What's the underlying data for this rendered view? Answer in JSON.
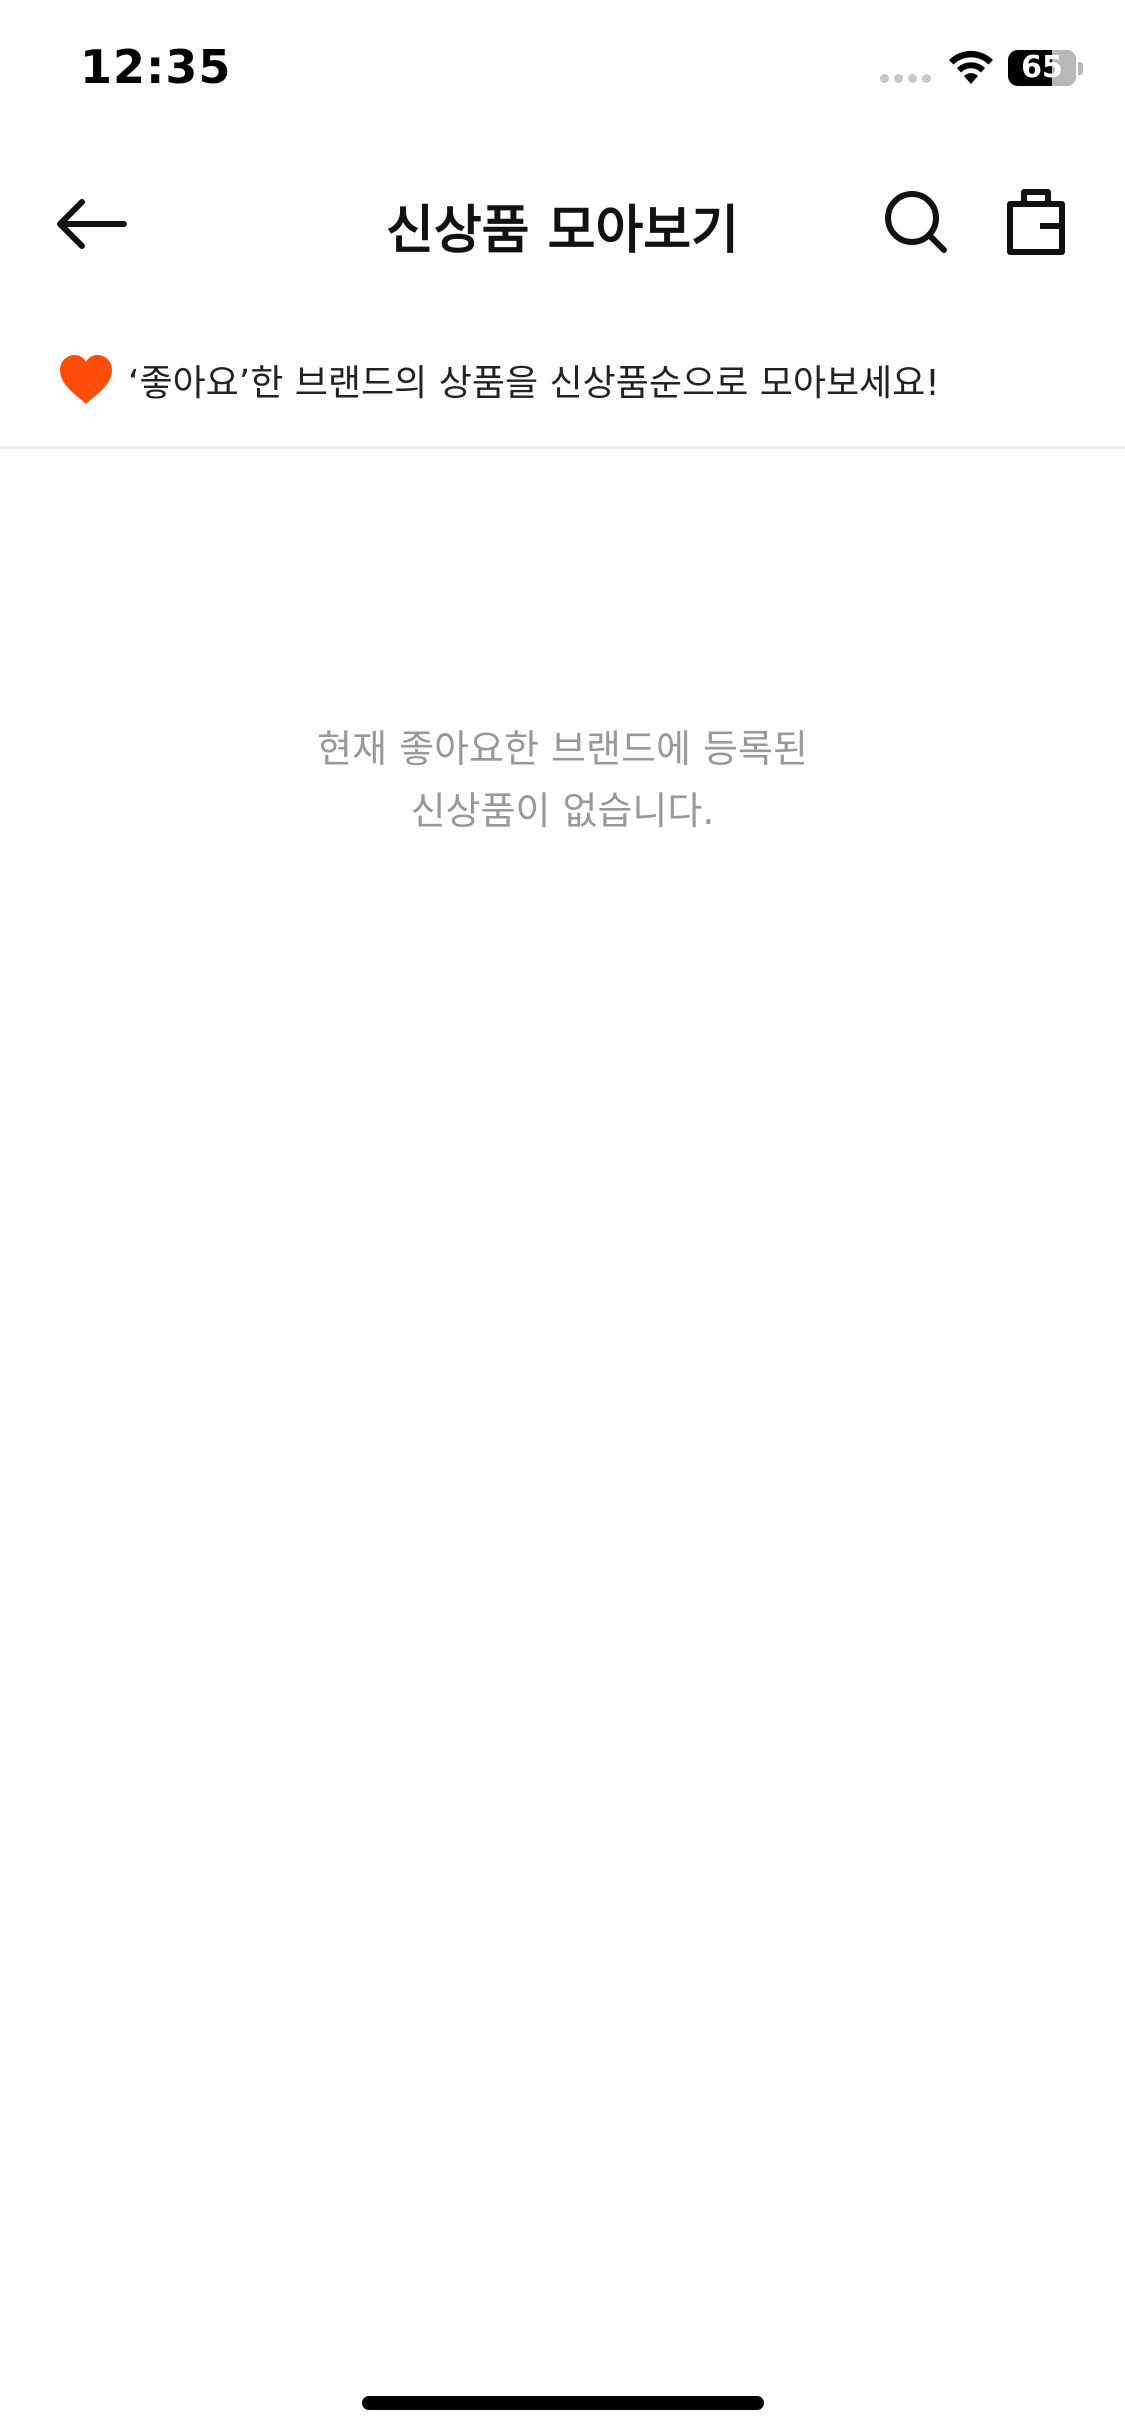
{
  "status_bar": {
    "time": "12:35",
    "battery_level": "65",
    "icons": [
      "signal-dots-icon",
      "wifi-icon",
      "battery-icon"
    ]
  },
  "nav_bar": {
    "title": "신상품 모아보기",
    "icons": [
      "back-arrow-icon",
      "search-icon",
      "shopping-bag-icon"
    ]
  },
  "banner": {
    "icon": "heart-icon",
    "text": "‘좋아요’한 브랜드의 상품을 신상품순으로 모아보세요!",
    "heart_color": "#FF4E0A"
  },
  "empty_state": {
    "line1": "현재 좋아요한 브랜드에 등록된",
    "line2": "신상품이 없습니다."
  }
}
